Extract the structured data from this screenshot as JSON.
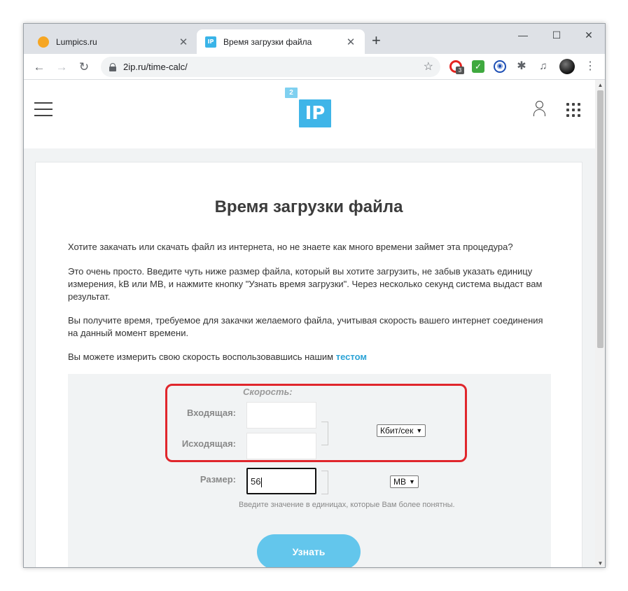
{
  "browser": {
    "tabs": [
      {
        "title": "Lumpics.ru",
        "active": false
      },
      {
        "title": "Время загрузки файла",
        "active": true
      }
    ],
    "new_tab": "+",
    "url": "2ip.ru/time-calc/",
    "controls": {
      "minimize": "—",
      "maximize": "☐",
      "close": "✕"
    },
    "ext_badge": "3"
  },
  "site": {
    "logo_small": "2",
    "logo_big": "IP"
  },
  "page": {
    "title": "Время загрузки файла",
    "para1": "Хотите закачать или скачать файл из интернета, но не знаете как много времени займет эта процедура?",
    "para2": "Это очень просто. Введите чуть ниже размер файла, который вы хотите загрузить, не забыв указать единицу измерения, kB или MB, и нажмите кнопку \"Узнать время загрузки\". Через несколько секунд система выдаст вам результат.",
    "para3": "Вы получите время, требуемое для закачки желаемого файла, учитывая скорость вашего интернет соединения на данный момент времени.",
    "para4_text": "Вы можете измерить свою скорость воспользовавшись нашим ",
    "para4_link": "тестом"
  },
  "calc": {
    "speed_label": "Скорость:",
    "incoming_label": "Входящая:",
    "incoming_value": "",
    "outgoing_label": "Исходящая:",
    "outgoing_value": "",
    "speed_unit": "Кбит/сек",
    "size_label": "Размер:",
    "size_value": "56",
    "size_unit": "MB",
    "hint": "Введите значение в единицах, которые Вам более понятны.",
    "submit": "Узнать"
  },
  "colors": {
    "accent": "#3fb5e8",
    "button": "#63c6ec",
    "highlight": "#e0262c"
  }
}
